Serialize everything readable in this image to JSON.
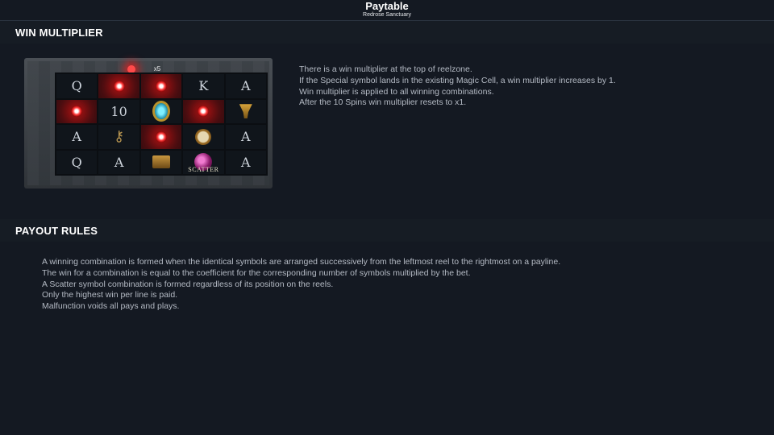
{
  "header": {
    "title": "Paytable",
    "subtitle": "Redrose Sanctuary"
  },
  "win_multiplier": {
    "heading": "WIN MULTIPLIER",
    "illustration": {
      "multiplier_label": "x5",
      "scatter_label": "SCATTER"
    },
    "lines": [
      "There is a win multiplier at the top of reelzone.",
      "If the Special symbol lands in the existing Magic Cell, a win multiplier increases by 1.",
      "Win multiplier is applied to all winning combinations.",
      "After the 10 Spins win multiplier resets to x1."
    ]
  },
  "payout_rules": {
    "heading": "PAYOUT RULES",
    "lines": [
      "A winning combination is formed when the identical symbols are arranged successively from the leftmost reel to the rightmost on a payline.",
      "The win for a combination is equal to the coefficient for the corresponding number of symbols multiplied by the bet.",
      "A Scatter symbol combination is formed regardless of its position on the reels.",
      "Only the highest win per line is paid.",
      "Malfunction voids all pays and plays."
    ]
  },
  "colors": {
    "background": "#141922",
    "section_head": "#161c24",
    "magic_glow": "#ff3a3a"
  }
}
